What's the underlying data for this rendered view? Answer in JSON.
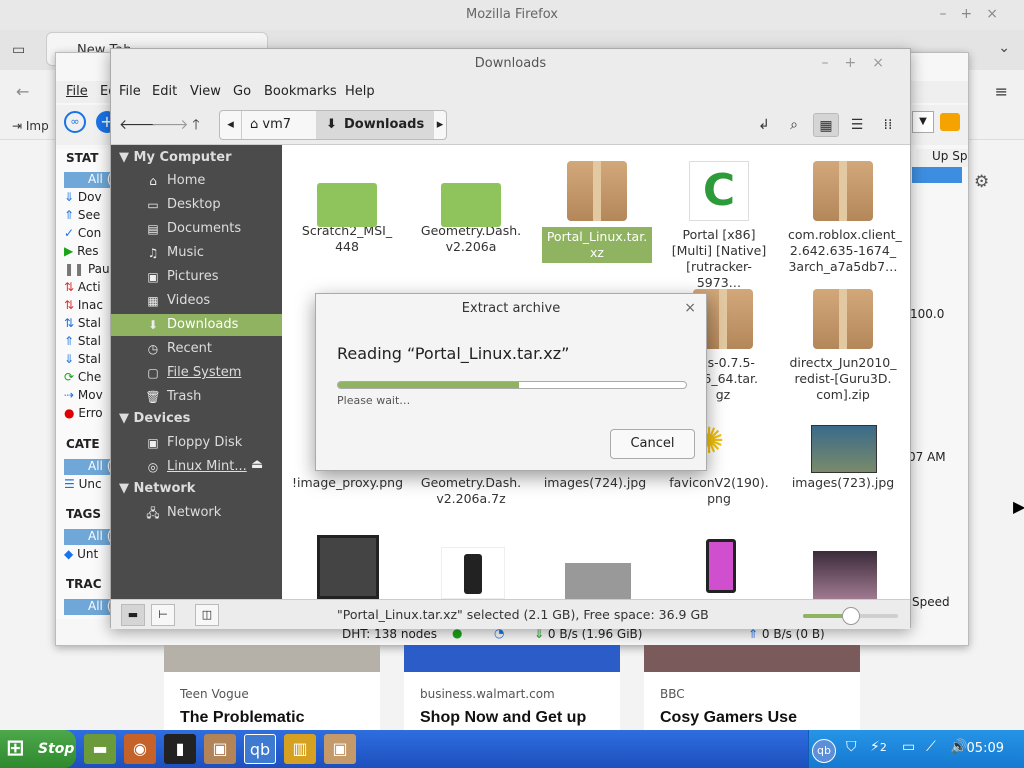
{
  "firefox": {
    "title": "Mozilla Firefox",
    "tab_label": "New Tab",
    "menu_file": "File",
    "menu_edit": "Ed",
    "import_label": "Imp"
  },
  "qbittorrent": {
    "file_menu": "File",
    "status_header": "STAT",
    "rows": [
      "All (",
      "Dov",
      "See",
      "Con",
      "Res",
      "Pau",
      "Acti",
      "Inac",
      "Stal",
      "Stal",
      "Stal",
      "Che",
      "Mov",
      "Erro"
    ],
    "categories_header": "CATE",
    "categories": [
      "All (",
      "Unc"
    ],
    "tags_header": "TAGS",
    "tags": [
      "All (",
      "Unt"
    ],
    "trackers_header": "TRAC",
    "trackers": [
      "All ("
    ],
    "col_up_speed": "Up Sp",
    "pct": "100.0",
    "time_am": "07 AM",
    "speed_col": "Speed",
    "dht": "DHT: 138 nodes",
    "down_speed": "0 B/s (1.96 GiB)",
    "up_speed": "0 B/s (0 B)"
  },
  "news_cards": [
    {
      "source": "Teen Vogue",
      "title": "The Problematic"
    },
    {
      "source": "business.walmart.com",
      "title": "Shop Now and Get up"
    },
    {
      "source": "BBC",
      "title": "Cosy Gamers Use"
    }
  ],
  "nemo": {
    "title": "Downloads",
    "menu": [
      "File",
      "Edit",
      "View",
      "Go",
      "Bookmarks",
      "Help"
    ],
    "crumb_home": "vm7",
    "crumb_current": "Downloads",
    "sidebar": {
      "my_computer": "My Computer",
      "places": [
        "Home",
        "Desktop",
        "Documents",
        "Music",
        "Pictures",
        "Videos",
        "Downloads",
        "Recent",
        "File System",
        "Trash"
      ],
      "devices_header": "Devices",
      "devices": [
        "Floppy Disk",
        "Linux Mint..."
      ],
      "network_header": "Network",
      "network": [
        "Network"
      ]
    },
    "files": [
      "Scratch2_MSI_\n448",
      "Geometry.Dash.\nv2.206a",
      "Portal_Linux.tar.\nxz",
      "Portal [x86]\n[Multi] [Native]\n[rutracker-5973…",
      "com.roblox.client_\n2.642.635-1674_\n3arch_a7a5db7…",
      "rlds-0.7.5-\nx86_64.tar.\ngz",
      "directx_Jun2010_\nredist-[Guru3D.\ncom].zip",
      "!image_proxy.png",
      "Geometry.Dash.\nv2.206a.7z",
      "images(724).jpg",
      "faviconV2(190).\npng",
      "images(723).jpg"
    ],
    "status": "\"Portal_Linux.tar.xz\" selected (2.1 GB), Free space: 36.9 GB",
    "zoom_level": 0.5
  },
  "dialog": {
    "title": "Extract archive",
    "heading": "Reading “Portal_Linux.tar.xz”",
    "progress": 0.52,
    "status": "Please wait…",
    "cancel": "Cancel"
  },
  "taskbar": {
    "start": "Stop",
    "clock": "05:09",
    "tray_count": "2"
  }
}
